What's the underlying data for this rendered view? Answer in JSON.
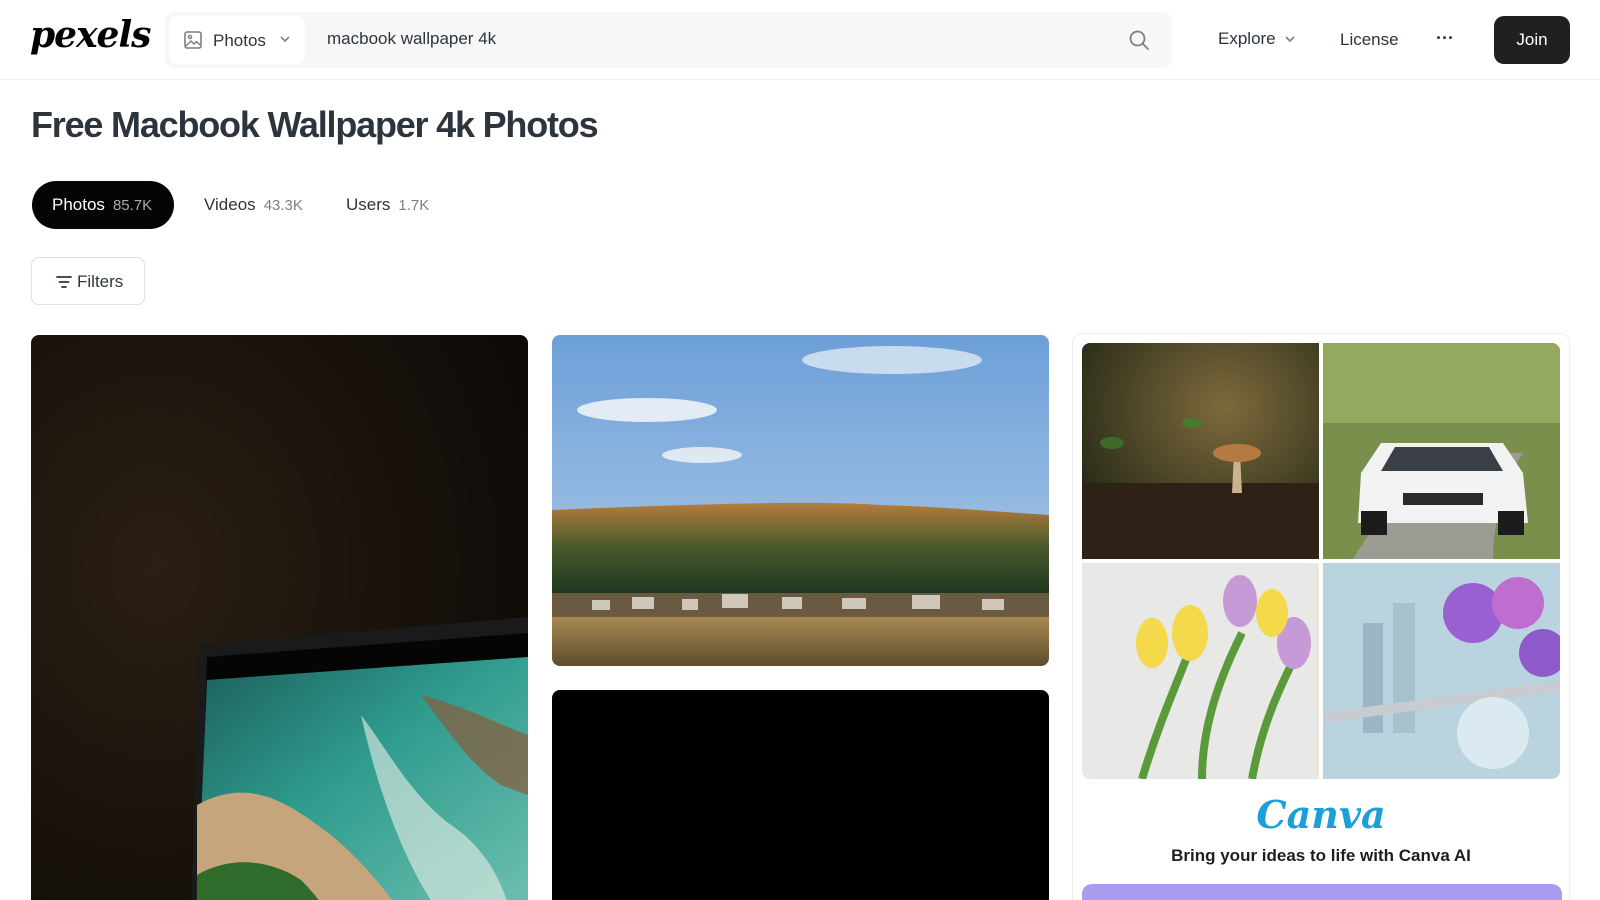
{
  "header": {
    "logo": "pexels",
    "search": {
      "type_label": "Photos",
      "query": "macbook wallpaper 4k"
    },
    "nav": {
      "explore": "Explore",
      "license": "License",
      "more": "···",
      "join": "Join"
    }
  },
  "page": {
    "title": "Free Macbook Wallpaper 4k Photos"
  },
  "tabs": [
    {
      "label": "Photos",
      "count": "85.7K",
      "active": true
    },
    {
      "label": "Videos",
      "count": "43.3K"
    },
    {
      "label": "Users",
      "count": "1.7K"
    }
  ],
  "filters": {
    "label": "Filters"
  },
  "ad": {
    "brand": "Canva",
    "tagline": "Bring your ideas to life with Canva AI"
  },
  "colors": {
    "active_tab": "#050505",
    "join_button": "#202020",
    "canva_brand": "#1a9fd6",
    "cta": "#a89cf0"
  },
  "icons": [
    "image-icon",
    "chevron-down-icon",
    "search-icon",
    "more-icon",
    "filter-icon"
  ]
}
